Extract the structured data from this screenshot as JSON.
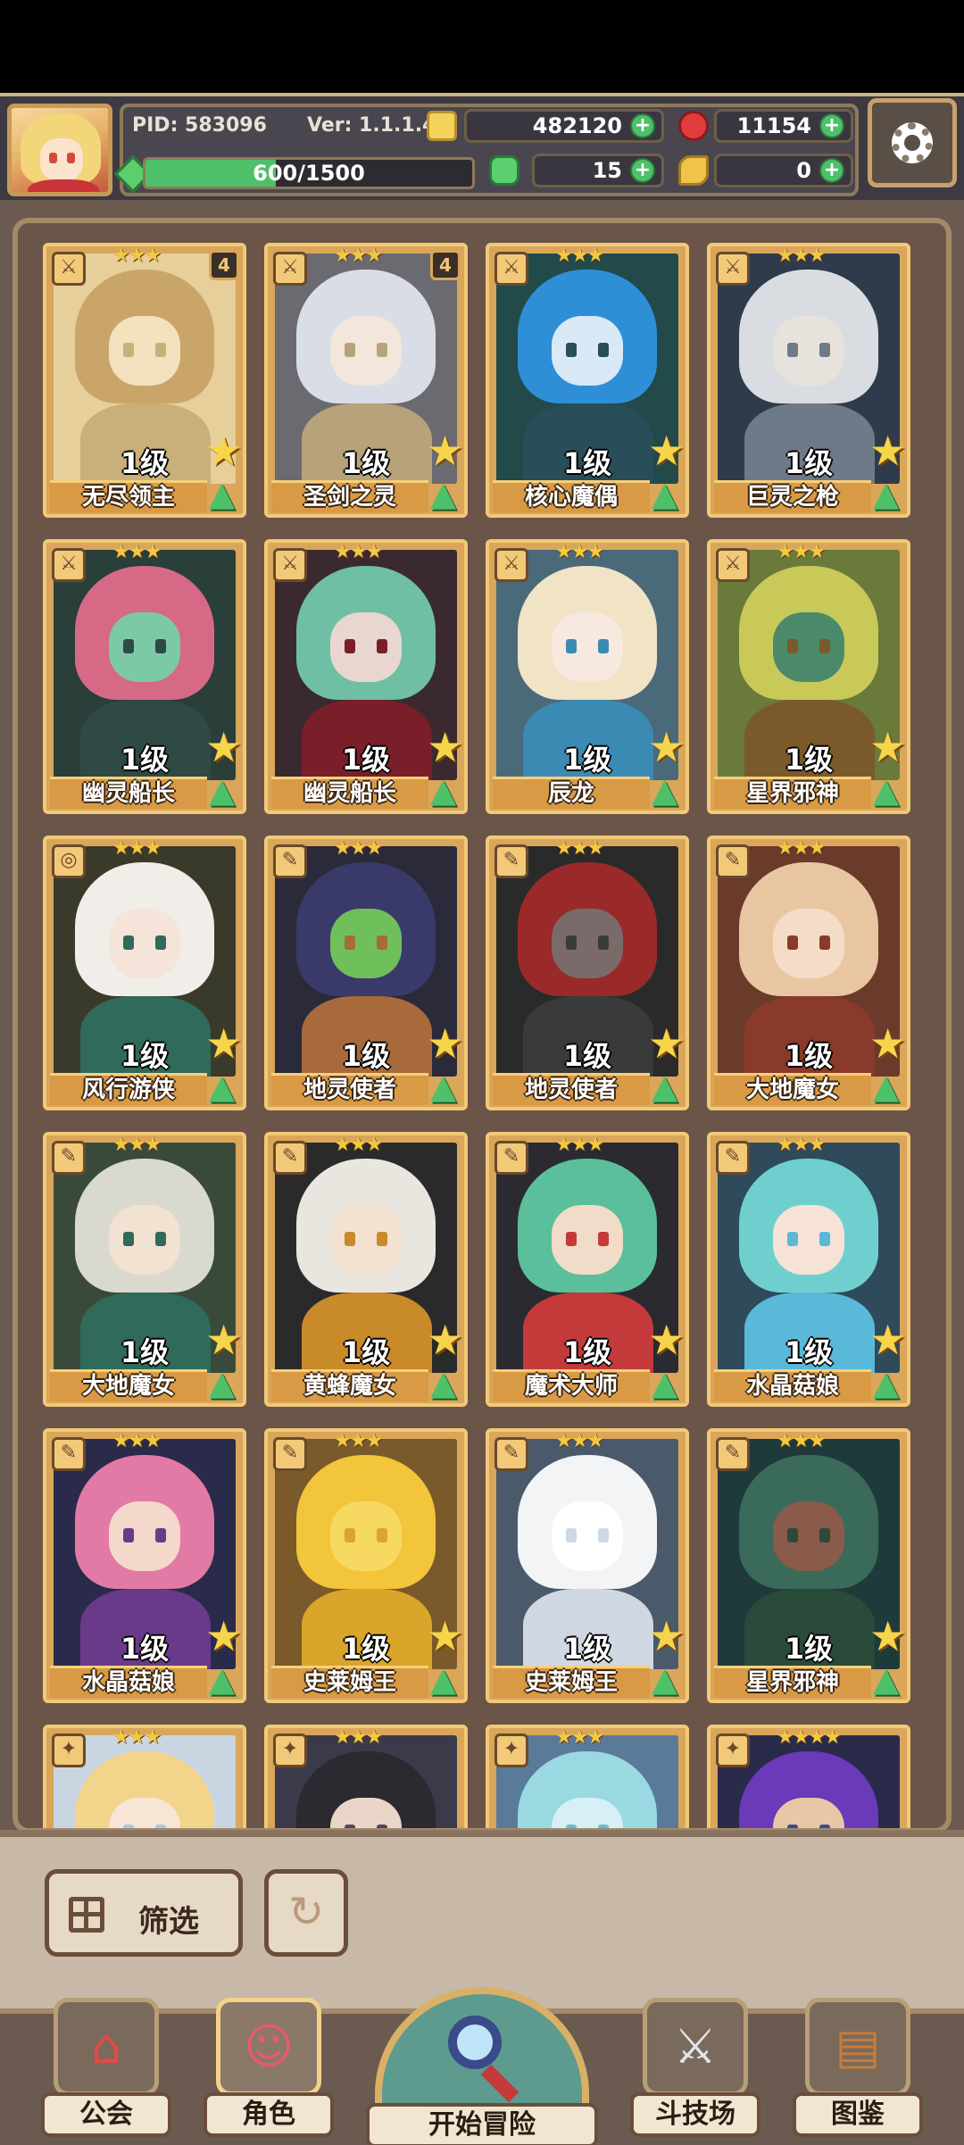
{
  "header": {
    "pid": "PID: 583096",
    "version": "Ver: 1.1.1.4",
    "xp_text": "600/1500",
    "xp_fraction": 0.4,
    "gold": "482120",
    "gems": "11154",
    "clovers": "15",
    "keys": "0"
  },
  "cards": [
    {
      "name": "无尽领主",
      "level": "1级",
      "stars": "★★★",
      "count": "4",
      "type": "⚔",
      "palette": [
        "#e7cf9c",
        "#caa56a",
        "#f3e2bd",
        "#c9b07a"
      ]
    },
    {
      "name": "圣剑之灵",
      "level": "1级",
      "stars": "★★★",
      "count": "4",
      "type": "⚔",
      "palette": [
        "#6a6a70",
        "#d8dde6",
        "#f3e7dc",
        "#b8a27a"
      ]
    },
    {
      "name": "核心魔偶",
      "level": "1级",
      "stars": "★★★",
      "count": "",
      "type": "⚔",
      "palette": [
        "#234a4a",
        "#2e8fd6",
        "#d9e9f5",
        "#2a4d5a"
      ]
    },
    {
      "name": "巨灵之枪",
      "level": "1级",
      "stars": "★★★",
      "count": "",
      "type": "⚔",
      "palette": [
        "#2f3b4a",
        "#d9dde2",
        "#e8e2dc",
        "#6e7a88"
      ]
    },
    {
      "name": "幽灵船长",
      "level": "1级",
      "stars": "★★★",
      "count": "",
      "type": "⚔",
      "palette": [
        "#2a3e3a",
        "#d66a86",
        "#7cc9a8",
        "#2f4a44"
      ]
    },
    {
      "name": "幽灵船长",
      "level": "1级",
      "stars": "★★★",
      "count": "",
      "type": "⚔",
      "palette": [
        "#3a2a30",
        "#6fbfa4",
        "#e9d6d0",
        "#7a1e2a"
      ]
    },
    {
      "name": "辰龙",
      "level": "1级",
      "stars": "★★★",
      "count": "",
      "type": "⚔",
      "palette": [
        "#4a6a7a",
        "#f1e3c6",
        "#f7e9df",
        "#3b8ab3"
      ]
    },
    {
      "name": "星界邪神",
      "level": "1级",
      "stars": "★★★",
      "count": "",
      "type": "⚔",
      "palette": [
        "#6a7a3a",
        "#c9c95a",
        "#4a8a6a",
        "#7a5a2a"
      ]
    },
    {
      "name": "风行游侠",
      "level": "1级",
      "stars": "★★★",
      "count": "",
      "type": "◎",
      "palette": [
        "#3a3a2a",
        "#f1ede8",
        "#f5e4da",
        "#2f6a5a"
      ]
    },
    {
      "name": "地灵使者",
      "level": "1级",
      "stars": "★★★",
      "count": "",
      "type": "✎",
      "palette": [
        "#2a2a3a",
        "#3a3a6a",
        "#6fbf5a",
        "#a86a3a"
      ]
    },
    {
      "name": "地灵使者",
      "level": "1级",
      "stars": "★★★",
      "count": "",
      "type": "✎",
      "palette": [
        "#2a2a2a",
        "#9a2a2a",
        "#7a6a6a",
        "#3a3a3a"
      ]
    },
    {
      "name": "大地魔女",
      "level": "1级",
      "stars": "★★★",
      "count": "",
      "type": "✎",
      "palette": [
        "#6a3a2a",
        "#e8c6a2",
        "#f5dcc8",
        "#8a3a2a"
      ]
    },
    {
      "name": "大地魔女",
      "level": "1级",
      "stars": "★★★",
      "count": "",
      "type": "✎",
      "palette": [
        "#3a4a3a",
        "#d9d9d0",
        "#f1e2d2",
        "#2f6a5a"
      ]
    },
    {
      "name": "黄蜂魔女",
      "level": "1级",
      "stars": "★★★",
      "count": "",
      "type": "✎",
      "palette": [
        "#2a2a2a",
        "#e9e6df",
        "#f4e2d0",
        "#c98a2a"
      ]
    },
    {
      "name": "魔术大师",
      "level": "1级",
      "stars": "★★★",
      "count": "",
      "type": "✎",
      "palette": [
        "#2a2a30",
        "#5abf9a",
        "#f0dcc8",
        "#c43a3a"
      ]
    },
    {
      "name": "水晶菇娘",
      "level": "1级",
      "stars": "★★★",
      "count": "",
      "type": "✎",
      "palette": [
        "#2f4a5a",
        "#6fcfcf",
        "#f6e3d6",
        "#5ab9d9"
      ]
    },
    {
      "name": "水晶菇娘",
      "level": "1级",
      "stars": "★★★",
      "count": "",
      "type": "✎",
      "palette": [
        "#2a2a4a",
        "#e27aa6",
        "#f4d8cc",
        "#6a3a8a"
      ]
    },
    {
      "name": "史莱姆王",
      "level": "1级",
      "stars": "★★★",
      "count": "",
      "type": "✎",
      "palette": [
        "#7a5a2a",
        "#f2c53a",
        "#f7d860",
        "#d9a52a"
      ]
    },
    {
      "name": "史莱姆王",
      "level": "1级",
      "stars": "★★★",
      "count": "",
      "type": "✎",
      "palette": [
        "#4a5a6a",
        "#f2f4f6",
        "#ffffff",
        "#cfd8e2"
      ]
    },
    {
      "name": "星界邪神",
      "level": "1级",
      "stars": "★★★",
      "count": "",
      "type": "✎",
      "palette": [
        "#1f3a3a",
        "#3a6a5a",
        "#8a5a4a",
        "#2a4a3a"
      ]
    },
    {
      "name": "",
      "level": "",
      "stars": "★★★",
      "count": "",
      "type": "✦",
      "palette": [
        "#c9d6e2",
        "#f2d58a",
        "#f7e6d6",
        "#aac7e2"
      ]
    },
    {
      "name": "",
      "level": "",
      "stars": "★★★",
      "count": "",
      "type": "✦",
      "palette": [
        "#3a3a4a",
        "#2a2a30",
        "#e9d6c8",
        "#4a4a5a"
      ]
    },
    {
      "name": "",
      "level": "",
      "stars": "★★★",
      "count": "",
      "type": "✦",
      "palette": [
        "#5a7a9a",
        "#9ad9e2",
        "#d6f0f5",
        "#6ab9cf"
      ]
    },
    {
      "name": "",
      "level": "",
      "stars": "★★★★",
      "count": "",
      "type": "✦",
      "palette": [
        "#2a2a4a",
        "#6a3ab9",
        "#e9c6a6",
        "#3a4a9a"
      ]
    }
  ],
  "controls": {
    "filter_label": "筛选",
    "refresh_icon": "refresh-icon"
  },
  "nav": {
    "guild": "公会",
    "characters": "角色",
    "adventure": "开始冒险",
    "arena": "斗技场",
    "codex": "图鉴"
  }
}
